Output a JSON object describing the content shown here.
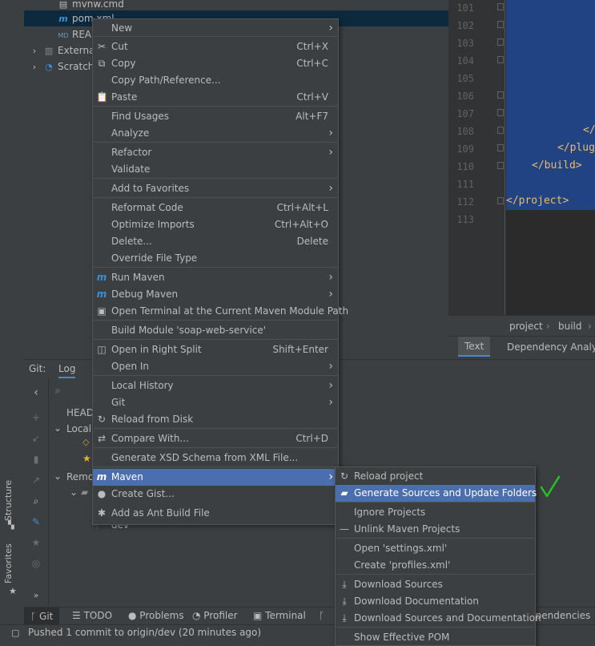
{
  "tree": {
    "items": [
      {
        "label": "mvnw.cmd",
        "icon": "file-icon"
      },
      {
        "label": "pom.xml",
        "icon": "maven-icon"
      },
      {
        "label": "README.md",
        "icon": "markdown-icon"
      },
      {
        "label": "External Libraries",
        "icon": "library-icon"
      },
      {
        "label": "Scratches and Consoles",
        "icon": "scratch-icon"
      }
    ]
  },
  "editor": {
    "line_numbers": [
      "101",
      "102",
      "103",
      "104",
      "105",
      "106",
      "107",
      "108",
      "109",
      "110",
      "111",
      "112",
      "113"
    ],
    "code_lines": [
      "</",
      "</plugins>",
      "</build>",
      "</project>"
    ],
    "breadcrumb": [
      "project",
      "build"
    ],
    "tabs": [
      "Text",
      "Dependency Analyzer"
    ]
  },
  "git": {
    "label": "Git:",
    "tab": "Log",
    "tree": [
      "HEAD",
      "Local",
      "Remote",
      "dev"
    ]
  },
  "side_tabs": [
    "Structure",
    "Favorites"
  ],
  "tool_tabs": [
    "Git",
    "TODO",
    "Problems",
    "Profiler",
    "Terminal",
    "Dependencies"
  ],
  "status": "Pushed 1 commit to origin/dev (20 minutes ago)",
  "context_menu": {
    "items": [
      {
        "label": "New",
        "shortcut": "",
        "submenu": true,
        "icon": ""
      },
      {
        "label": "Cut",
        "shortcut": "Ctrl+X",
        "submenu": false,
        "icon": "✂"
      },
      {
        "label": "Copy",
        "shortcut": "Ctrl+C",
        "submenu": false,
        "icon": "⧉"
      },
      {
        "label": "Copy Path/Reference...",
        "shortcut": "",
        "submenu": false,
        "icon": ""
      },
      {
        "label": "Paste",
        "shortcut": "Ctrl+V",
        "submenu": false,
        "icon": "📋"
      },
      {
        "label": "Find Usages",
        "shortcut": "Alt+F7",
        "submenu": false,
        "icon": ""
      },
      {
        "label": "Analyze",
        "shortcut": "",
        "submenu": true,
        "icon": ""
      },
      {
        "label": "Refactor",
        "shortcut": "",
        "submenu": true,
        "icon": ""
      },
      {
        "label": "Validate",
        "shortcut": "",
        "submenu": false,
        "icon": ""
      },
      {
        "label": "Add to Favorites",
        "shortcut": "",
        "submenu": true,
        "icon": ""
      },
      {
        "label": "Reformat Code",
        "shortcut": "Ctrl+Alt+L",
        "submenu": false,
        "icon": ""
      },
      {
        "label": "Optimize Imports",
        "shortcut": "Ctrl+Alt+O",
        "submenu": false,
        "icon": ""
      },
      {
        "label": "Delete...",
        "shortcut": "Delete",
        "submenu": false,
        "icon": ""
      },
      {
        "label": "Override File Type",
        "shortcut": "",
        "submenu": false,
        "icon": ""
      },
      {
        "label": "Run Maven",
        "shortcut": "",
        "submenu": true,
        "icon": "m"
      },
      {
        "label": "Debug Maven",
        "shortcut": "",
        "submenu": true,
        "icon": "m"
      },
      {
        "label": "Open Terminal at the Current Maven Module Path",
        "shortcut": "",
        "submenu": false,
        "icon": "▣"
      },
      {
        "label": "Build Module 'soap-web-service'",
        "shortcut": "",
        "submenu": false,
        "icon": ""
      },
      {
        "label": "Open in Right Split",
        "shortcut": "Shift+Enter",
        "submenu": false,
        "icon": "◫"
      },
      {
        "label": "Open In",
        "shortcut": "",
        "submenu": true,
        "icon": ""
      },
      {
        "label": "Local History",
        "shortcut": "",
        "submenu": true,
        "icon": ""
      },
      {
        "label": "Git",
        "shortcut": "",
        "submenu": true,
        "icon": ""
      },
      {
        "label": "Reload from Disk",
        "shortcut": "",
        "submenu": false,
        "icon": "↻"
      },
      {
        "label": "Compare With...",
        "shortcut": "Ctrl+D",
        "submenu": false,
        "icon": "⇄"
      },
      {
        "label": "Generate XSD Schema from XML File...",
        "shortcut": "",
        "submenu": false,
        "icon": ""
      },
      {
        "label": "Maven",
        "shortcut": "",
        "submenu": true,
        "icon": "m"
      },
      {
        "label": "Create Gist...",
        "shortcut": "",
        "submenu": false,
        "icon": "●"
      },
      {
        "label": "Add as Ant Build File",
        "shortcut": "",
        "submenu": false,
        "icon": "✱"
      }
    ]
  },
  "maven_submenu": {
    "items": [
      {
        "label": "Reload project",
        "icon": "↻"
      },
      {
        "label": "Generate Sources and Update Folders",
        "icon": "▰"
      },
      {
        "label": "Ignore Projects",
        "icon": ""
      },
      {
        "label": "Unlink Maven Projects",
        "icon": "—"
      },
      {
        "label": "Open 'settings.xml'",
        "icon": ""
      },
      {
        "label": "Create 'profiles.xml'",
        "icon": ""
      },
      {
        "label": "Download Sources",
        "icon": "⤓"
      },
      {
        "label": "Download Documentation",
        "icon": "⤓"
      },
      {
        "label": "Download Sources and Documentation",
        "icon": "⤓"
      },
      {
        "label": "Show Effective POM",
        "icon": ""
      }
    ]
  },
  "colors": {
    "highlight": "#4b6eaf",
    "checkmark": "#22c322",
    "maven_icon": "#3d8fd1"
  }
}
